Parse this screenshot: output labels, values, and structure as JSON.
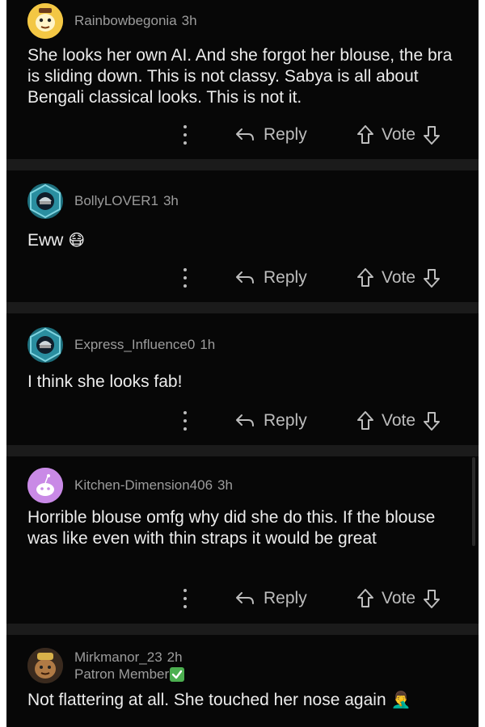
{
  "comments": [
    {
      "user": "Rainbowbegonia",
      "time": "3h",
      "avatar_icon": "yellow-cartoon-avatar-icon",
      "text": "She looks her own AI. And she forgot her blouse, the bra is sliding down. This is not classy. Sabya is all about Bengali classical looks. This is not it.",
      "reply_label": "Reply",
      "vote_label": "Vote"
    },
    {
      "user": "BollyLOVER1",
      "time": "3h",
      "avatar_icon": "blue-hexagon-robot-avatar-icon",
      "text": "Eww",
      "emoji": "😷",
      "reply_label": "Reply",
      "vote_label": "Vote"
    },
    {
      "user": "Express_Influence0",
      "time": "1h",
      "avatar_icon": "blue-hexagon-robot-avatar-icon",
      "text": "I think she looks fab!",
      "reply_label": "Reply",
      "vote_label": "Vote"
    },
    {
      "user": "Kitchen-Dimension406",
      "time": "3h",
      "avatar_icon": "purple-snoo-avatar-icon",
      "text": "Horrible blouse omfg why did she do this. If the blouse was like even with thin straps it would be great",
      "reply_label": "Reply",
      "vote_label": "Vote"
    },
    {
      "user": "Mirkmanor_23",
      "time": "2h",
      "flair": "Patron Member",
      "flair_icon": "green-check-icon",
      "avatar_icon": "brown-cartoon-avatar-icon",
      "text": "Not flattering at all. She touched her nose again",
      "emoji": "🤦‍♂️"
    }
  ],
  "colors": {
    "background": "#070707",
    "separator": "#1b1b1b",
    "username": "#9c9c9c",
    "body_text": "#ececec",
    "action": "#bdbdbd",
    "flair_check": "#4caf50"
  }
}
